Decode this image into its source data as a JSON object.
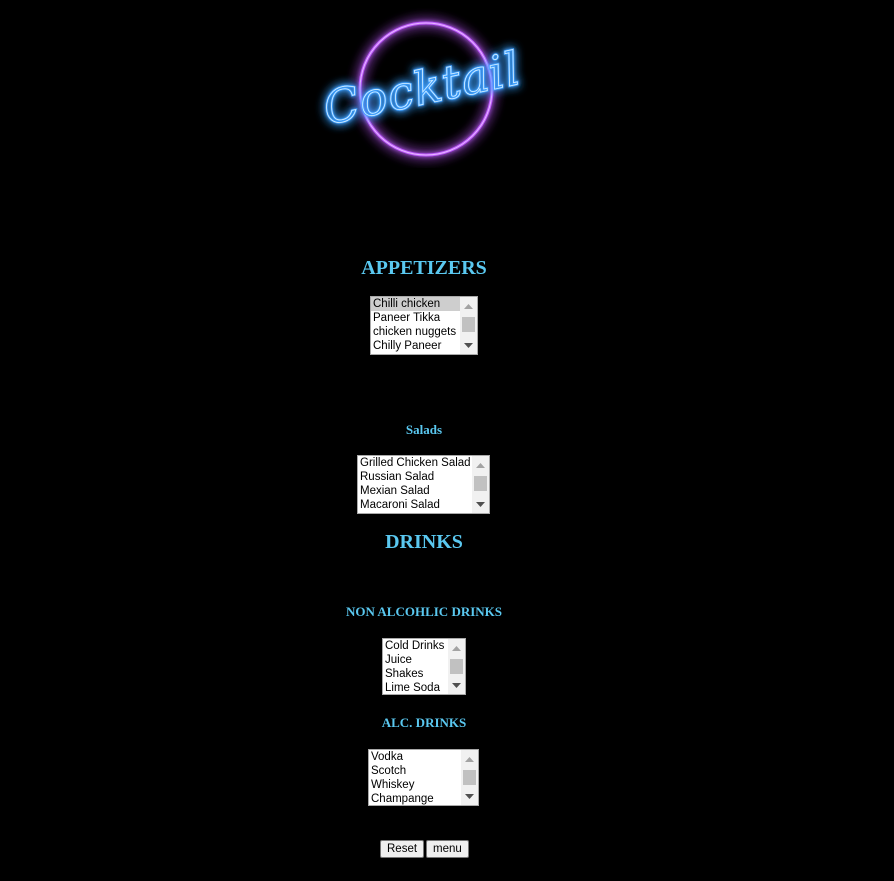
{
  "logo": {
    "text": "Cocktail"
  },
  "sections": {
    "appetizers": {
      "title": "APPETIZERS",
      "items": [
        "Chilli chicken",
        "Paneer Tikka",
        "chicken nuggets",
        "Chilly Paneer"
      ]
    },
    "salads": {
      "title": "Salads",
      "items": [
        "Grilled Chicken Salad",
        "Russian Salad",
        "Mexian Salad",
        "Macaroni Salad"
      ]
    },
    "drinks": {
      "title": "DRINKS"
    },
    "non_alcoholic": {
      "title": "NON ALCOHLIC DRINKS",
      "items": [
        "Cold Drinks",
        "Juice",
        "Shakes",
        "Lime Soda"
      ]
    },
    "alcoholic": {
      "title": "ALC. DRINKS",
      "items": [
        "Vodka",
        "Scotch",
        "Whiskey",
        "Champange"
      ]
    }
  },
  "buttons": {
    "reset": "Reset",
    "menu": "menu"
  },
  "colors": {
    "heading": "#5ac8f0",
    "neon_ring": "#b44cff",
    "neon_text": "#2f8bff",
    "background": "#000000"
  }
}
